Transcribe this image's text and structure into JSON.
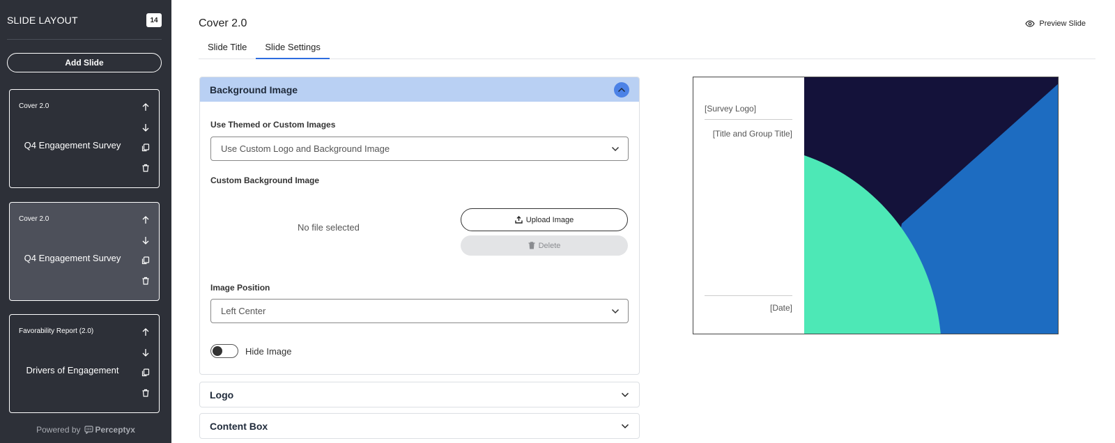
{
  "sidebar": {
    "title": "SLIDE LAYOUT",
    "count": "14",
    "add_slide_label": "Add Slide",
    "slides": [
      {
        "type": "Cover 2.0",
        "name": "Q4 Engagement Survey",
        "active": false
      },
      {
        "type": "Cover 2.0",
        "name": "Q4 Engagement Survey",
        "active": true
      },
      {
        "type": "Favorability Report (2.0)",
        "name": "Drivers of Engagement",
        "active": false
      }
    ],
    "footer_powered": "Powered by",
    "footer_brand": "Perceptyx"
  },
  "header": {
    "title": "Cover 2.0",
    "preview_label": "Preview Slide",
    "tabs": [
      {
        "label": "Slide Title",
        "active": false
      },
      {
        "label": "Slide Settings",
        "active": true
      }
    ]
  },
  "background_panel": {
    "title": "Background Image",
    "themed_label": "Use Themed or Custom Images",
    "themed_value": "Use Custom Logo and Background Image",
    "custom_bg_label": "Custom Background Image",
    "no_file_text": "No file selected",
    "upload_label": "Upload Image",
    "delete_label": "Delete",
    "position_label": "Image Position",
    "position_value": "Left Center",
    "hide_label": "Hide Image",
    "hide_enabled": false
  },
  "collapsed_sections": [
    {
      "title": "Logo"
    },
    {
      "title": "Content Box"
    }
  ],
  "preview": {
    "logo_placeholder": "[Survey Logo]",
    "title_placeholder": "[Title and Group Title]",
    "date_placeholder": "[Date]"
  },
  "colors": {
    "sidebar_bg": "#2d3038",
    "accent": "#2d6cdf",
    "panel_header": "#b9d0f3",
    "preview_navy": "#14123a",
    "preview_blue": "#1d6cc1",
    "preview_mint": "#4de8b6"
  }
}
